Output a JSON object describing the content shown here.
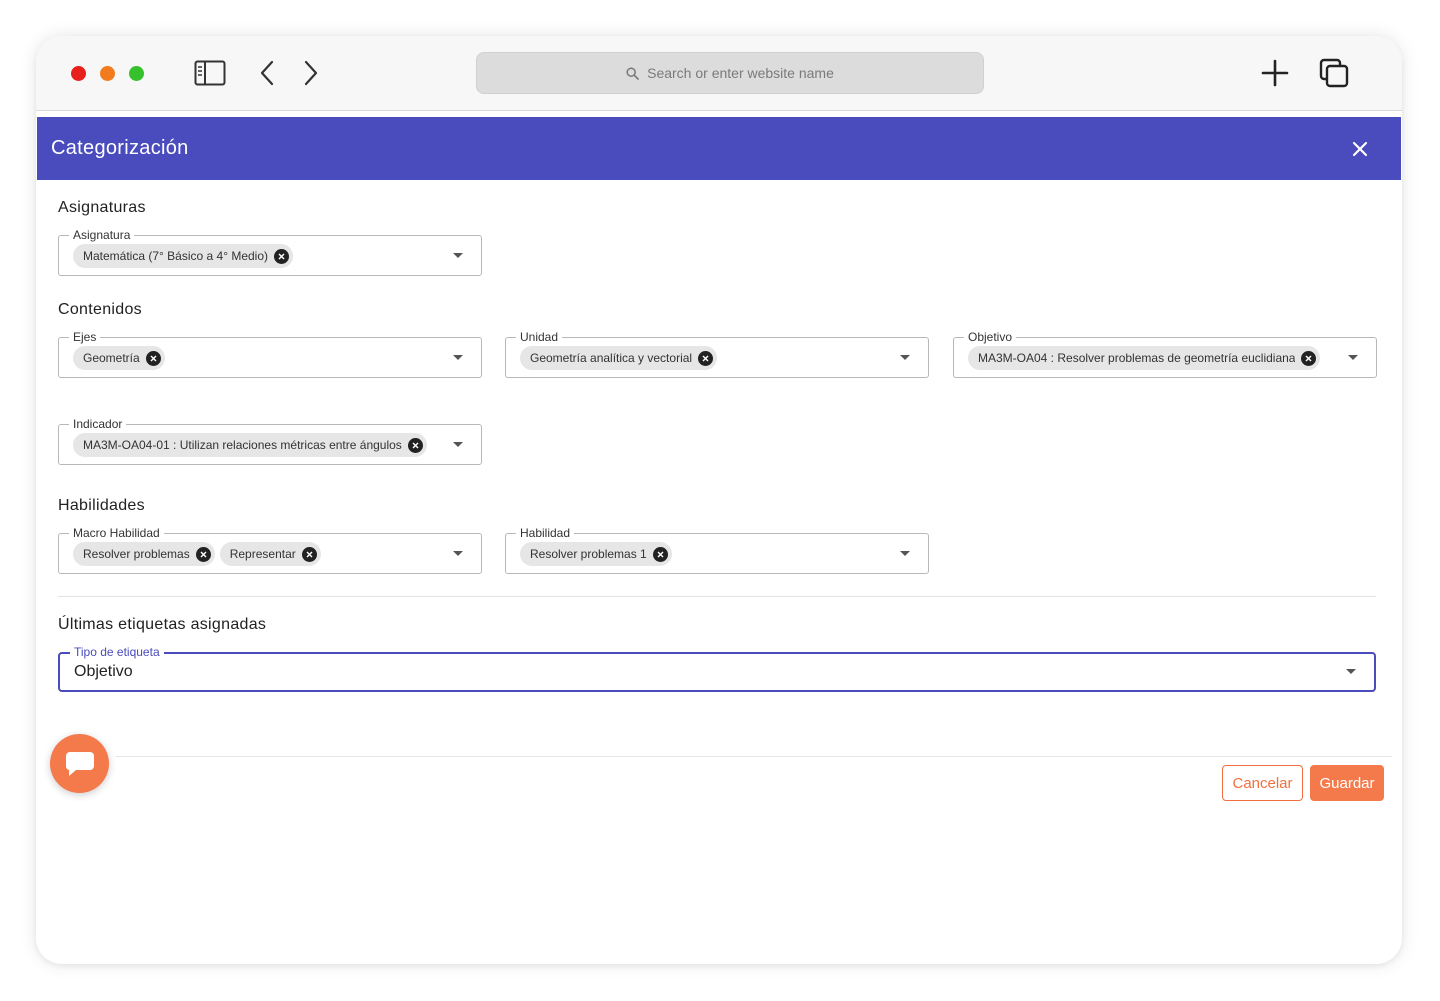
{
  "browser": {
    "address_placeholder": "Search or enter website name",
    "icons": [
      "sidebar-icon",
      "back-icon",
      "forward-icon",
      "search-icon",
      "new-tab-icon",
      "tabs-overview-icon"
    ]
  },
  "modal": {
    "title": "Categorización",
    "accent_color": "#4a4bbd"
  },
  "asignaturas": {
    "section_title": "Asignaturas",
    "asignatura": {
      "label": "Asignatura",
      "chips": [
        "Matemática (7° Básico a 4° Medio)"
      ]
    }
  },
  "contenidos": {
    "section_title": "Contenidos",
    "ejes": {
      "label": "Ejes",
      "chips": [
        "Geometría"
      ]
    },
    "unidad": {
      "label": "Unidad",
      "chips": [
        "Geometría analítica y vectorial"
      ]
    },
    "objetivo": {
      "label": "Objetivo",
      "chips": [
        "MA3M-OA04 : Resolver problemas de geometría euclidiana"
      ]
    },
    "indicador": {
      "label": "Indicador",
      "chips": [
        "MA3M-OA04-01 : Utilizan relaciones métricas entre ángulos"
      ]
    }
  },
  "habilidades": {
    "section_title": "Habilidades",
    "macro_habilidad": {
      "label": "Macro Habilidad",
      "chips": [
        "Resolver problemas",
        "Representar"
      ]
    },
    "habilidad": {
      "label": "Habilidad",
      "chips": [
        "Resolver problemas 1"
      ]
    }
  },
  "ultimas": {
    "section_title": "Últimas etiquetas asignadas",
    "tipo_label": "Tipo de etiqueta",
    "tipo_value": "Objetivo"
  },
  "footer": {
    "cancel_label": "Cancelar",
    "save_label": "Guardar",
    "button_color": "#f47a4c"
  },
  "chat": {
    "icon": "chat-bubble-icon"
  }
}
